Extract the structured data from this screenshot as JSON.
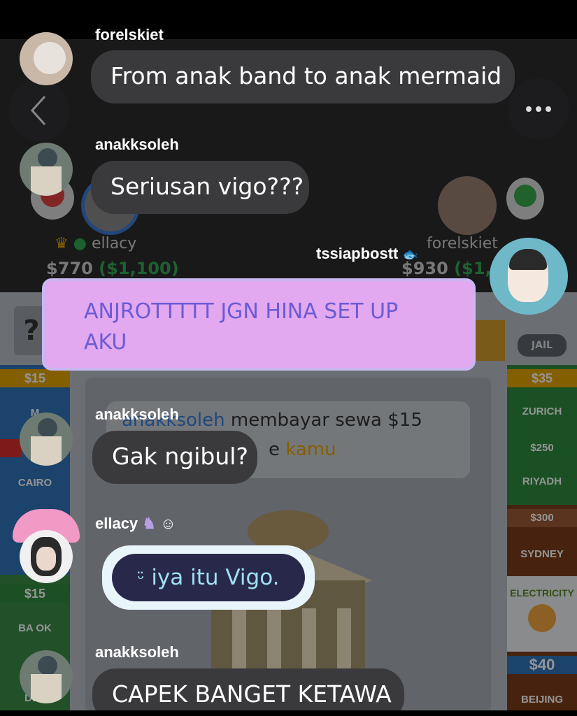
{
  "players": {
    "left": {
      "name": "ellacy",
      "money": "$770",
      "money_total": "($1,100)"
    },
    "right": {
      "name": "forelskiet",
      "money": "$930",
      "money_total": "($1,"
    }
  },
  "board": {
    "left_tiles": [
      {
        "price": "$15",
        "name": "M"
      },
      {
        "price": "",
        "name": "CAIRO"
      },
      {
        "price": "",
        "name": ""
      },
      {
        "price": "$15",
        "name": "BA    OK"
      },
      {
        "price": "",
        "name": "DEL"
      }
    ],
    "right_tiles": [
      {
        "price": "$35",
        "name": "ZURICH"
      },
      {
        "price": "$250",
        "name": "RIYADH"
      },
      {
        "price": "$300",
        "name": "SYDNEY"
      },
      {
        "price": "",
        "name": "ELECTRICITY"
      },
      {
        "price": "$40",
        "name": "BEIJING"
      }
    ],
    "jail_label": "JAIL",
    "notice": {
      "user": "anakksoleh",
      "text1": " membayar sewa $15",
      "text2": "e ",
      "highlight": "kamu"
    }
  },
  "chat": [
    {
      "user": "forelskiet",
      "text": "From anak band to anak mermaid"
    },
    {
      "user": "anakksoleh",
      "text": "Seriusan vigo???"
    },
    {
      "user": "tssiapbostt",
      "text": "ANJROTTTTT JGN HINA SET UP AKU"
    },
    {
      "user": "anakksoleh",
      "text": "Gak ngibul?"
    },
    {
      "user": "ellacy",
      "text": "iya itu Vigo."
    },
    {
      "user": "anakksoleh",
      "text": "CAPEK BANGET KETAWA"
    }
  ],
  "icons": {
    "back": "chevron-left-icon",
    "more": "more-dots-icon"
  }
}
